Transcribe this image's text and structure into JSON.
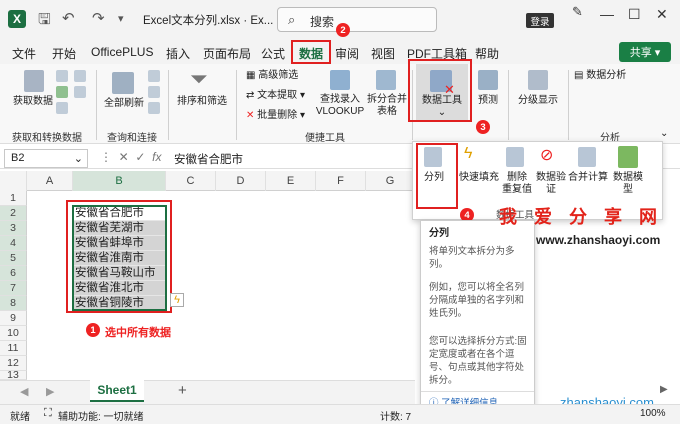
{
  "titlebar": {
    "logo": "X",
    "undo_icon": "undo-icon",
    "redo_icon": "redo-icon",
    "file_title": "Excel文本分列.xlsx  ·  Ex...",
    "search_placeholder": "搜索",
    "login": "登录",
    "minimize": "—",
    "maximize": "☐",
    "close": "✕"
  },
  "menu": {
    "items": [
      "文件",
      "开始",
      "OfficePLUS",
      "插入",
      "页面布局",
      "公式",
      "数据",
      "审阅",
      "视图",
      "PDF工具箱",
      "帮助"
    ],
    "share": "共享"
  },
  "ribbon": {
    "get_data": "获取数据",
    "refresh_all": "全部刷新",
    "sort_filter": "排序和筛选",
    "adv_filter": "高级筛选",
    "text_extract": "文本提取",
    "batch_delete": "批量删除",
    "find_vlookup": "查找录入\nVLOOKUP",
    "split_merge": "拆分合并\n表格",
    "data_tools": "数据工具",
    "forecast": "预测",
    "outline": "分级显示",
    "data_analysis": "数据分析",
    "groups": [
      "获取和转换数据",
      "查询和连接",
      "便捷工具",
      "分析"
    ]
  },
  "formula": {
    "namebox": "B2",
    "fx": "fx",
    "content": "安徽省合肥市"
  },
  "grid": {
    "columns": [
      "A",
      "B",
      "C",
      "D",
      "E",
      "F",
      "G",
      "H"
    ],
    "rows": [
      "1",
      "2",
      "3",
      "4",
      "5",
      "6",
      "7",
      "8",
      "9",
      "10",
      "11",
      "12",
      "13"
    ],
    "cells": [
      "安徽省合肥市",
      "安徽省芜湖市",
      "安徽省蚌埠市",
      "安徽省淮南市",
      "安徽省马鞍山市",
      "安徽省淮北市",
      "安徽省铜陵市"
    ]
  },
  "dropdown": {
    "items": [
      "分列",
      "快速填充",
      "删除\n重复值",
      "数据验\n证",
      "合并计算",
      "数据模\n型"
    ],
    "group_label": "数据工具"
  },
  "tooltip": {
    "title": "分列",
    "p1": "将单列文本拆分为多列。",
    "p2": "例如，您可以将全名列分隔成单独的名字列和姓氏列。",
    "p3": "您可以选择拆分方式:固定宽度或者在各个逗号、句点或其他字符处拆分。",
    "link": "了解详细信息"
  },
  "callouts": {
    "c1": "1",
    "c1_text": "选中所有数据",
    "c2": "2",
    "c3": "3",
    "c4": "4"
  },
  "watermark": {
    "title": "我 爱 分 享 网",
    "url": "www.zhanshaoyi.com",
    "bottom": "zhanshaoyi.com"
  },
  "sheet": {
    "tab": "Sheet1",
    "add": "+"
  },
  "status": {
    "ready": "就绪",
    "accessibility": "辅助功能: 一切就绪",
    "count": "计数: 7",
    "zoom": "100%"
  }
}
